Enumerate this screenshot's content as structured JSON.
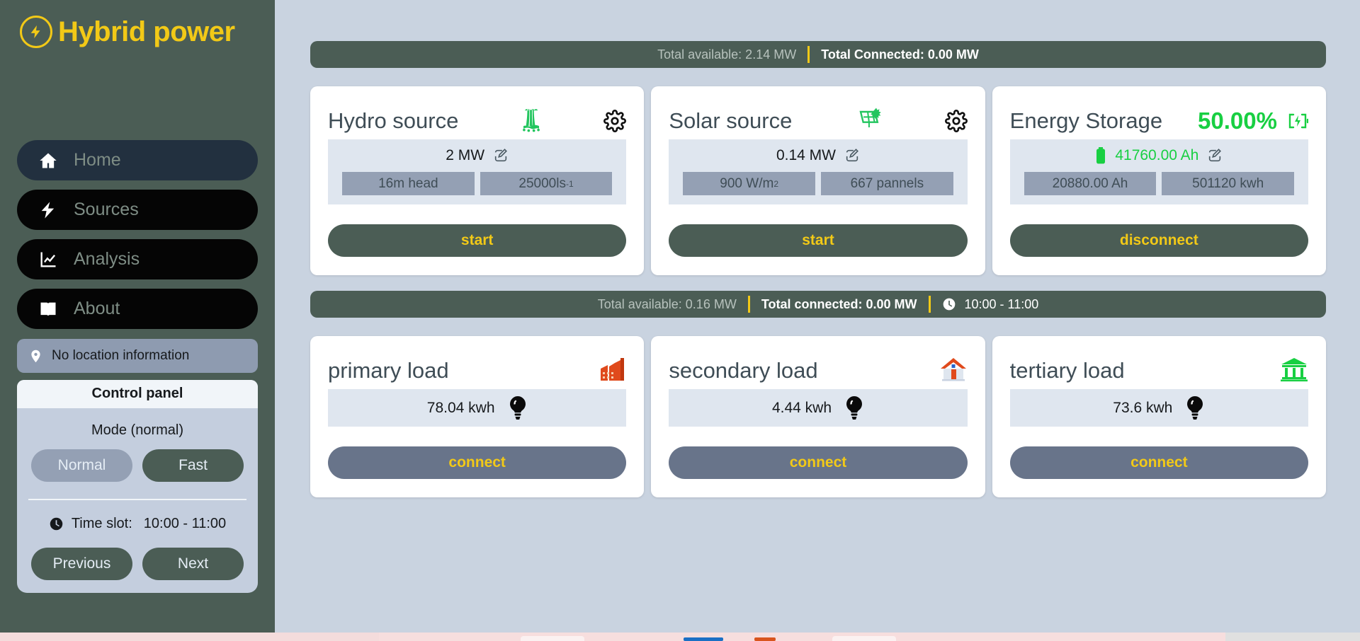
{
  "brand": {
    "title": "Hybrid power",
    "logo_icon": "lightning-bolt-circle-icon",
    "accent": "#f2c917"
  },
  "sidebar": {
    "nav": [
      {
        "label": "Home",
        "icon": "home-icon",
        "active": true
      },
      {
        "label": "Sources",
        "icon": "bolt-icon",
        "active": false
      },
      {
        "label": "Analysis",
        "icon": "chart-line-icon",
        "active": false
      },
      {
        "label": "About",
        "icon": "book-icon",
        "active": false
      }
    ],
    "location": {
      "text": "No location information",
      "icon": "map-pin-icon"
    },
    "control_panel": {
      "header": "Control panel",
      "mode_label": "Mode (normal)",
      "mode_buttons": [
        {
          "label": "Normal",
          "selected": true
        },
        {
          "label": "Fast",
          "selected": false
        }
      ],
      "timeslot_icon": "clock-icon",
      "timeslot_label": "Time slot:",
      "timeslot_value": "10:00 - 11:00",
      "nav_buttons": [
        {
          "label": "Previous"
        },
        {
          "label": "Next"
        }
      ]
    }
  },
  "sources_status": {
    "available": "Total available: 2.14 MW",
    "connected": "Total Connected: 0.00 MW"
  },
  "loads_status": {
    "available": "Total available: 0.16 MW",
    "connected": "Total connected: 0.00 MW",
    "clock_icon": "clock-icon",
    "timeslot": "10:00 - 11:00"
  },
  "sources": [
    {
      "title": "Hydro source",
      "emoji": "🌊",
      "icon": "waterfall-icon",
      "gear_icon": "gear-icon",
      "edit_icon": "edit-icon",
      "power": "2 MW",
      "chips": [
        {
          "text": "16m head",
          "sup": ""
        },
        {
          "text": "25000ls",
          "sup": "-1"
        }
      ],
      "action": "start"
    },
    {
      "title": "Solar source",
      "emoji": "☀",
      "icon": "solar-panel-icon",
      "gear_icon": "gear-icon",
      "edit_icon": "edit-icon",
      "power": "0.14 MW",
      "chips": [
        {
          "text": "900 W/m",
          "sup": "2"
        },
        {
          "text": "667 pannels",
          "sup": ""
        }
      ],
      "action": "start"
    }
  ],
  "storage": {
    "title": "Energy Storage",
    "percent": "50.00%",
    "percent_color": "#18cf42",
    "charge_icon": "battery-charging-icon",
    "battery_icon": "battery-full-icon",
    "edit_icon": "edit-icon",
    "capacity": "41760.00 Ah",
    "chips": [
      {
        "text": "20880.00 Ah",
        "sup": ""
      },
      {
        "text": "501120 kwh",
        "sup": ""
      }
    ],
    "action": "disconnect"
  },
  "loads": [
    {
      "title": "primary load",
      "icon": "factory-icon",
      "bulb_icon": "lightbulb-icon",
      "value": "78.04 kwh",
      "action": "connect"
    },
    {
      "title": "secondary load",
      "icon": "house-icon",
      "bulb_icon": "lightbulb-icon",
      "value": "4.44 kwh",
      "action": "connect"
    },
    {
      "title": "tertiary load",
      "icon": "bank-icon",
      "bulb_icon": "lightbulb-icon",
      "value": "73.6 kwh",
      "action": "connect"
    }
  ]
}
